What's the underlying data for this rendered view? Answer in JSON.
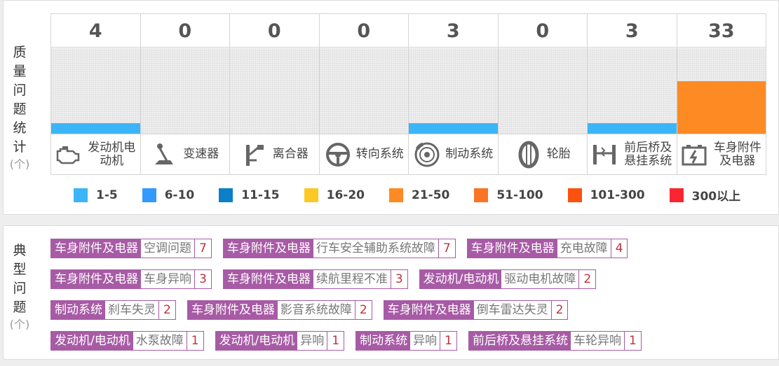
{
  "quality": {
    "title_chars": [
      "质",
      "量",
      "问",
      "题",
      "统",
      "计"
    ],
    "unit": "(个)",
    "columns": [
      {
        "count": "4",
        "label": "发动机电动机",
        "icon": "engine-icon",
        "level": 0
      },
      {
        "count": "0",
        "label": "变速器",
        "icon": "gear-lever-icon",
        "level": null
      },
      {
        "count": "0",
        "label": "离合器",
        "icon": "clutch-icon",
        "level": null
      },
      {
        "count": "0",
        "label": "转向系统",
        "icon": "steering-wheel-icon",
        "level": null
      },
      {
        "count": "3",
        "label": "制动系统",
        "icon": "brake-disc-icon",
        "level": 0
      },
      {
        "count": "0",
        "label": "轮胎",
        "icon": "tire-icon",
        "level": null
      },
      {
        "count": "3",
        "label": "前后桥及悬挂系统",
        "icon": "suspension-icon",
        "level": 0
      },
      {
        "count": "33",
        "label": "车身附件及电器",
        "icon": "battery-icon",
        "level": 4
      }
    ]
  },
  "legend": [
    {
      "label": "1-5",
      "color": "#3cb5f8"
    },
    {
      "label": "6-10",
      "color": "#3399ff"
    },
    {
      "label": "11-15",
      "color": "#0b7fc8"
    },
    {
      "label": "16-20",
      "color": "#fcc826"
    },
    {
      "label": "21-50",
      "color": "#fd8a23"
    },
    {
      "label": "51-100",
      "color": "#fb7324"
    },
    {
      "label": "101-300",
      "color": "#fd5110"
    },
    {
      "label": "300以上",
      "color": "#fb2531"
    }
  ],
  "typical": {
    "title_chars": [
      "典",
      "型",
      "问",
      "题"
    ],
    "unit": "(个)",
    "rows": [
      [
        {
          "category": "车身附件及电器",
          "issue": "空调问题",
          "count": "7"
        },
        {
          "category": "车身附件及电器",
          "issue": "行车安全辅助系统故障",
          "count": "7"
        },
        {
          "category": "车身附件及电器",
          "issue": "充电故障",
          "count": "4"
        }
      ],
      [
        {
          "category": "车身附件及电器",
          "issue": "车身异响",
          "count": "3"
        },
        {
          "category": "车身附件及电器",
          "issue": "续航里程不准",
          "count": "3"
        },
        {
          "category": "发动机/电动机",
          "issue": "驱动电机故障",
          "count": "2"
        }
      ],
      [
        {
          "category": "制动系统",
          "issue": "刹车失灵",
          "count": "2"
        },
        {
          "category": "车身附件及电器",
          "issue": "影音系统故障",
          "count": "2"
        },
        {
          "category": "车身附件及电器",
          "issue": "倒车雷达失灵",
          "count": "2"
        }
      ],
      [
        {
          "category": "发动机/电动机",
          "issue": "水泵故障",
          "count": "1"
        },
        {
          "category": "发动机/电动机",
          "issue": "异响",
          "count": "1"
        },
        {
          "category": "制动系统",
          "issue": "异响",
          "count": "1"
        },
        {
          "category": "前后桥及悬挂系统",
          "issue": "车轮异响",
          "count": "1"
        }
      ]
    ]
  }
}
